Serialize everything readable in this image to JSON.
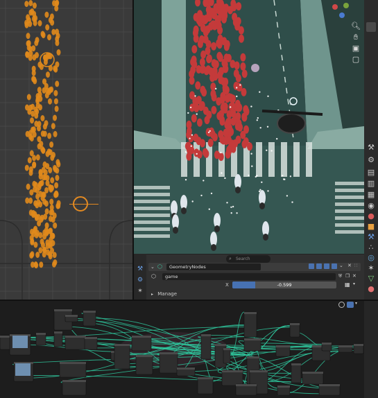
{
  "app": "Blender",
  "icons": {
    "zoom": "zoom-icon",
    "pan": "hand-pan-icon",
    "camera": "camera-icon",
    "lock": "lock-icon",
    "search": "search-icon"
  },
  "properties": {
    "search_placeholder": "Search",
    "modifier_name": "GeometryNodes",
    "node_group": "game",
    "x_label": "X",
    "x_value": "-0.599",
    "x_fraction": 0.22,
    "manage_label": "Manage"
  },
  "colors": {
    "crowd_red": "#c43a3a",
    "crowd_orange": "#e08a1c",
    "node_link": "#2fc69c",
    "slider_fill": "#4772b3",
    "road": "#2f4e4a"
  }
}
